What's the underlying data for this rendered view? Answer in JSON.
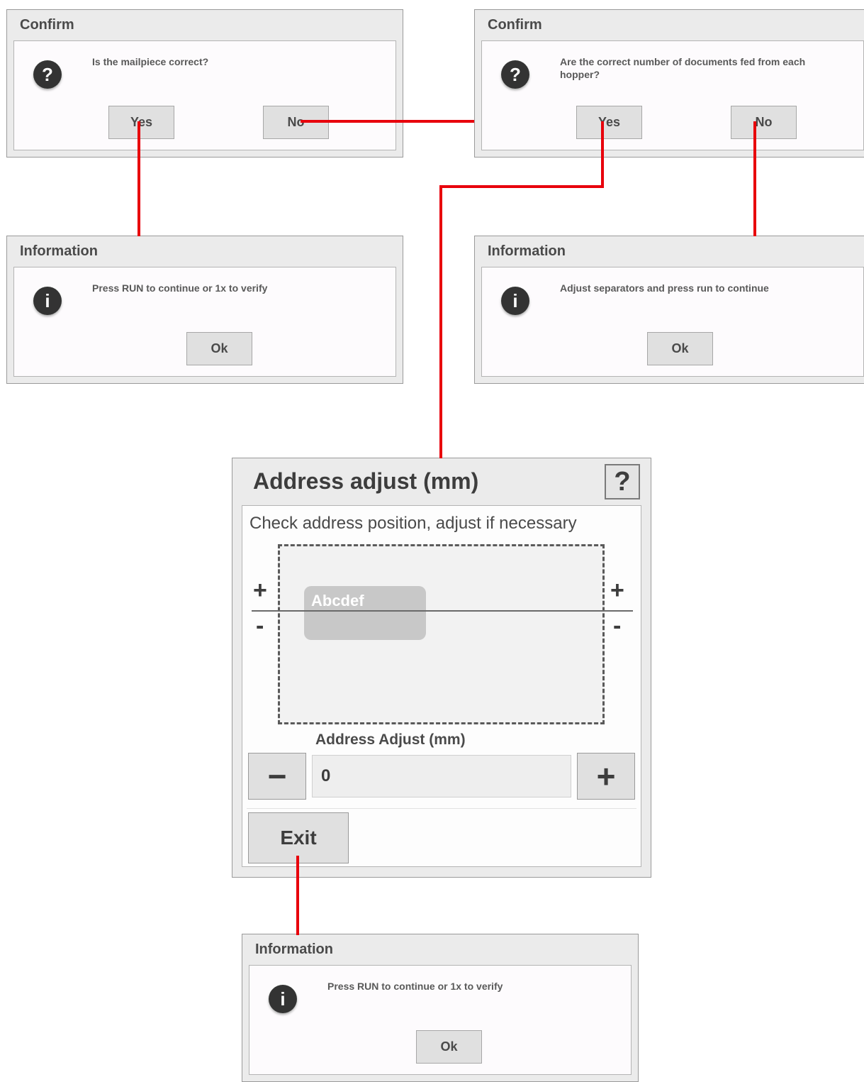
{
  "colors": {
    "connector": "#e8000b",
    "dialog_frame": "#ebebeb",
    "icon_circle": "#333333"
  },
  "confirm_mailpiece": {
    "title": "Confirm",
    "icon": "question-icon",
    "icon_glyph": "?",
    "message": "Is the mailpiece correct?",
    "yes_label": "Yes",
    "no_label": "No"
  },
  "confirm_documents": {
    "title": "Confirm",
    "icon": "question-icon",
    "icon_glyph": "?",
    "message": "Are the correct number of documents fed from each hopper?",
    "yes_label": "Yes",
    "no_label": "No"
  },
  "info_run_verify": {
    "title": "Information",
    "icon": "info-icon",
    "icon_glyph": "i",
    "message": "Press RUN to continue or 1x to verify",
    "ok_label": "Ok"
  },
  "info_separators": {
    "title": "Information",
    "icon": "info-icon",
    "icon_glyph": "i",
    "message": "Adjust separators and press run to continue",
    "ok_label": "Ok"
  },
  "address_adjust": {
    "title": "Address adjust (mm)",
    "help_label": "?",
    "instruction": "Check address position, adjust if necessary",
    "preview_sample": "Abcdef",
    "plus": "+",
    "minus": "-",
    "field_label": "Address Adjust (mm)",
    "decrement_label": "−",
    "increment_label": "+",
    "value": "0",
    "exit_label": "Exit"
  },
  "info_bottom": {
    "title": "Information",
    "icon": "info-icon",
    "icon_glyph": "i",
    "message": "Press RUN to continue or 1x to verify",
    "ok_label": "Ok"
  }
}
